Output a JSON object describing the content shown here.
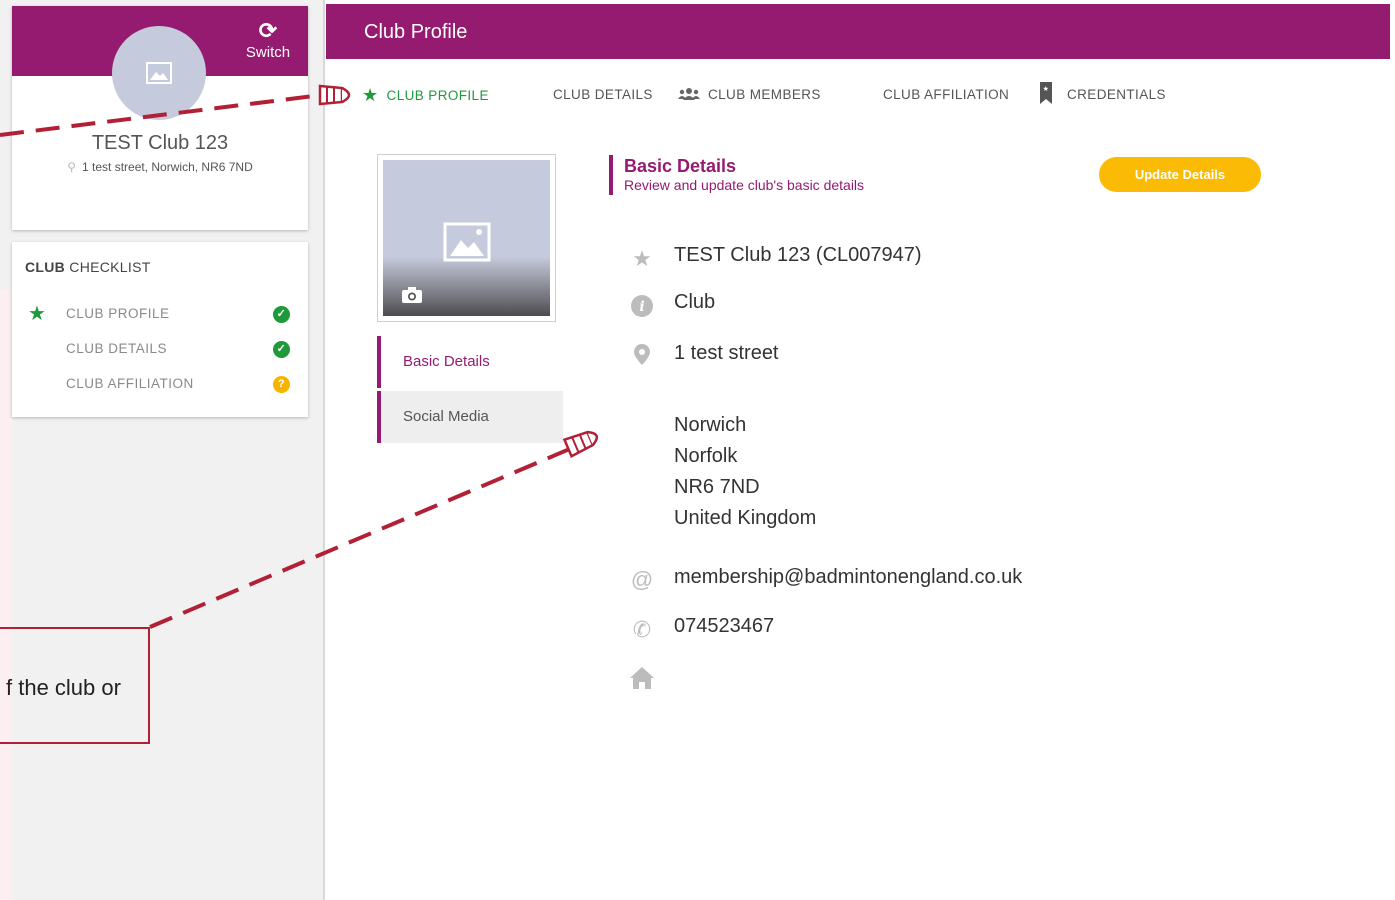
{
  "sidebar": {
    "switch_label": "Switch",
    "club_name": "TEST Club 123",
    "club_address": "1 test street, Norwich, NR6 7ND",
    "checklist": {
      "title_bold": "CLUB",
      "title_rest": "CHECKLIST",
      "items": [
        {
          "label": "CLUB PROFILE",
          "status": "complete",
          "current": true
        },
        {
          "label": "CLUB DETAILS",
          "status": "complete",
          "current": false
        },
        {
          "label": "CLUB AFFILIATION",
          "status": "pending",
          "current": false
        }
      ]
    }
  },
  "callout": {
    "text": "f the club or"
  },
  "main": {
    "title": "Club Profile",
    "tabs": [
      {
        "label": "CLUB PROFILE",
        "icon": "star-icon",
        "active": true
      },
      {
        "label": "CLUB DETAILS",
        "icon": "",
        "active": false
      },
      {
        "label": "CLUB MEMBERS",
        "icon": "users-icon",
        "active": false
      },
      {
        "label": "CLUB AFFILIATION",
        "icon": "",
        "active": false
      },
      {
        "label": "CREDENTIALS",
        "icon": "bookmark-icon",
        "active": false
      }
    ],
    "side_menu": [
      {
        "label": "Basic Details",
        "active": true
      },
      {
        "label": "Social Media",
        "active": false
      }
    ],
    "section": {
      "title": "Basic Details",
      "subtitle": "Review and update club's basic details"
    },
    "update_button": "Update Details",
    "details": {
      "name": "TEST Club 123 (CL007947)",
      "type": "Club",
      "address_line1": "1 test street",
      "city": "Norwich",
      "county": "Norfolk",
      "postcode": "NR6 7ND",
      "country": "United Kingdom",
      "email": "membership@badmintonengland.co.uk",
      "phone": "074523467",
      "website": ""
    }
  },
  "colors": {
    "brand": "#951b71",
    "success": "#1e9a3b",
    "warning": "#fbbb05",
    "annotation": "#b22036"
  }
}
